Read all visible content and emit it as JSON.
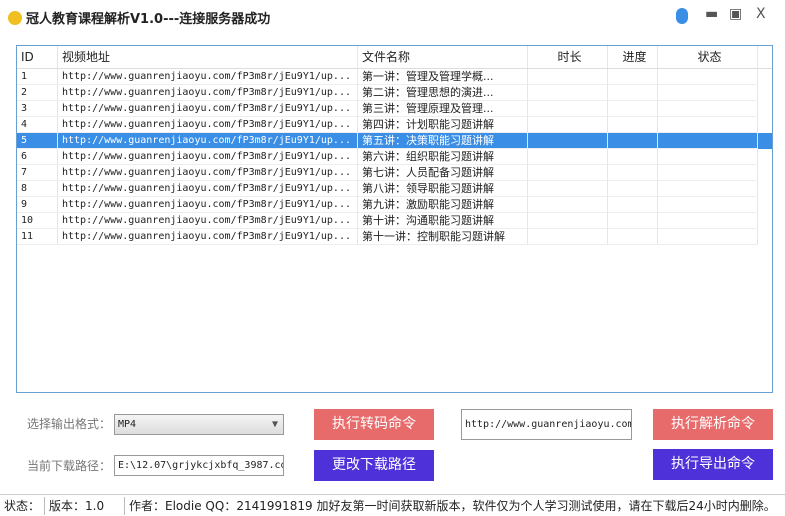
{
  "window": {
    "title": "冠人教育课程解析V1.0---连接服务器成功",
    "minimize": "▬",
    "maximize": "▣",
    "close": "X"
  },
  "table": {
    "headers": [
      "ID",
      "视频地址",
      "文件名称",
      "时长",
      "进度",
      "状态"
    ],
    "rows": [
      {
        "id": "1",
        "url": "http://www.guanrenjiaoyu.com/fP3m8r/jEu9Y1/up...",
        "name": "第一讲：管理及管理学概..."
      },
      {
        "id": "2",
        "url": "http://www.guanrenjiaoyu.com/fP3m8r/jEu9Y1/up...",
        "name": "第二讲：管理思想的演进..."
      },
      {
        "id": "3",
        "url": "http://www.guanrenjiaoyu.com/fP3m8r/jEu9Y1/up...",
        "name": "第三讲：管理原理及管理..."
      },
      {
        "id": "4",
        "url": "http://www.guanrenjiaoyu.com/fP3m8r/jEu9Y1/up...",
        "name": "第四讲：计划职能习题讲解"
      },
      {
        "id": "5",
        "url": "http://www.guanrenjiaoyu.com/fP3m8r/jEu9Y1/up...",
        "name": "第五讲：决策职能习题讲解",
        "selected": true
      },
      {
        "id": "6",
        "url": "http://www.guanrenjiaoyu.com/fP3m8r/jEu9Y1/up...",
        "name": "第六讲：组织职能习题讲解"
      },
      {
        "id": "7",
        "url": "http://www.guanrenjiaoyu.com/fP3m8r/jEu9Y1/up...",
        "name": "第七讲：人员配备习题讲解"
      },
      {
        "id": "8",
        "url": "http://www.guanrenjiaoyu.com/fP3m8r/jEu9Y1/up...",
        "name": "第八讲：领导职能习题讲解"
      },
      {
        "id": "9",
        "url": "http://www.guanrenjiaoyu.com/fP3m8r/jEu9Y1/up...",
        "name": "第九讲：激励职能习题讲解"
      },
      {
        "id": "10",
        "url": "http://www.guanrenjiaoyu.com/fP3m8r/jEu9Y1/up...",
        "name": "第十讲：沟通职能习题讲解"
      },
      {
        "id": "11",
        "url": "http://www.guanrenjiaoyu.com/fP3m8r/jEu9Y1/up...",
        "name": "第十一讲：控制职能习题讲解"
      }
    ]
  },
  "controls": {
    "format_label": "选择输出格式：",
    "format_value": "MP4",
    "path_label": "当前下载路径：",
    "path_value": "E:\\12.07\\grjykcjxbfq_3987.co",
    "url_value": "http://www.guanrenjiaoyu.com",
    "transcode_btn": "执行转码命令",
    "change_path_btn": "更改下载路径",
    "parse_btn": "执行解析命令",
    "export_btn": "执行导出命令"
  },
  "status": {
    "label": "状态：",
    "version": "版本：1.0",
    "author": "作者：Elodie QQ：2141991819 加好友第一时间获取新版本，软件仅为个人学习测试使用，请在下载后24小时内删除。"
  }
}
